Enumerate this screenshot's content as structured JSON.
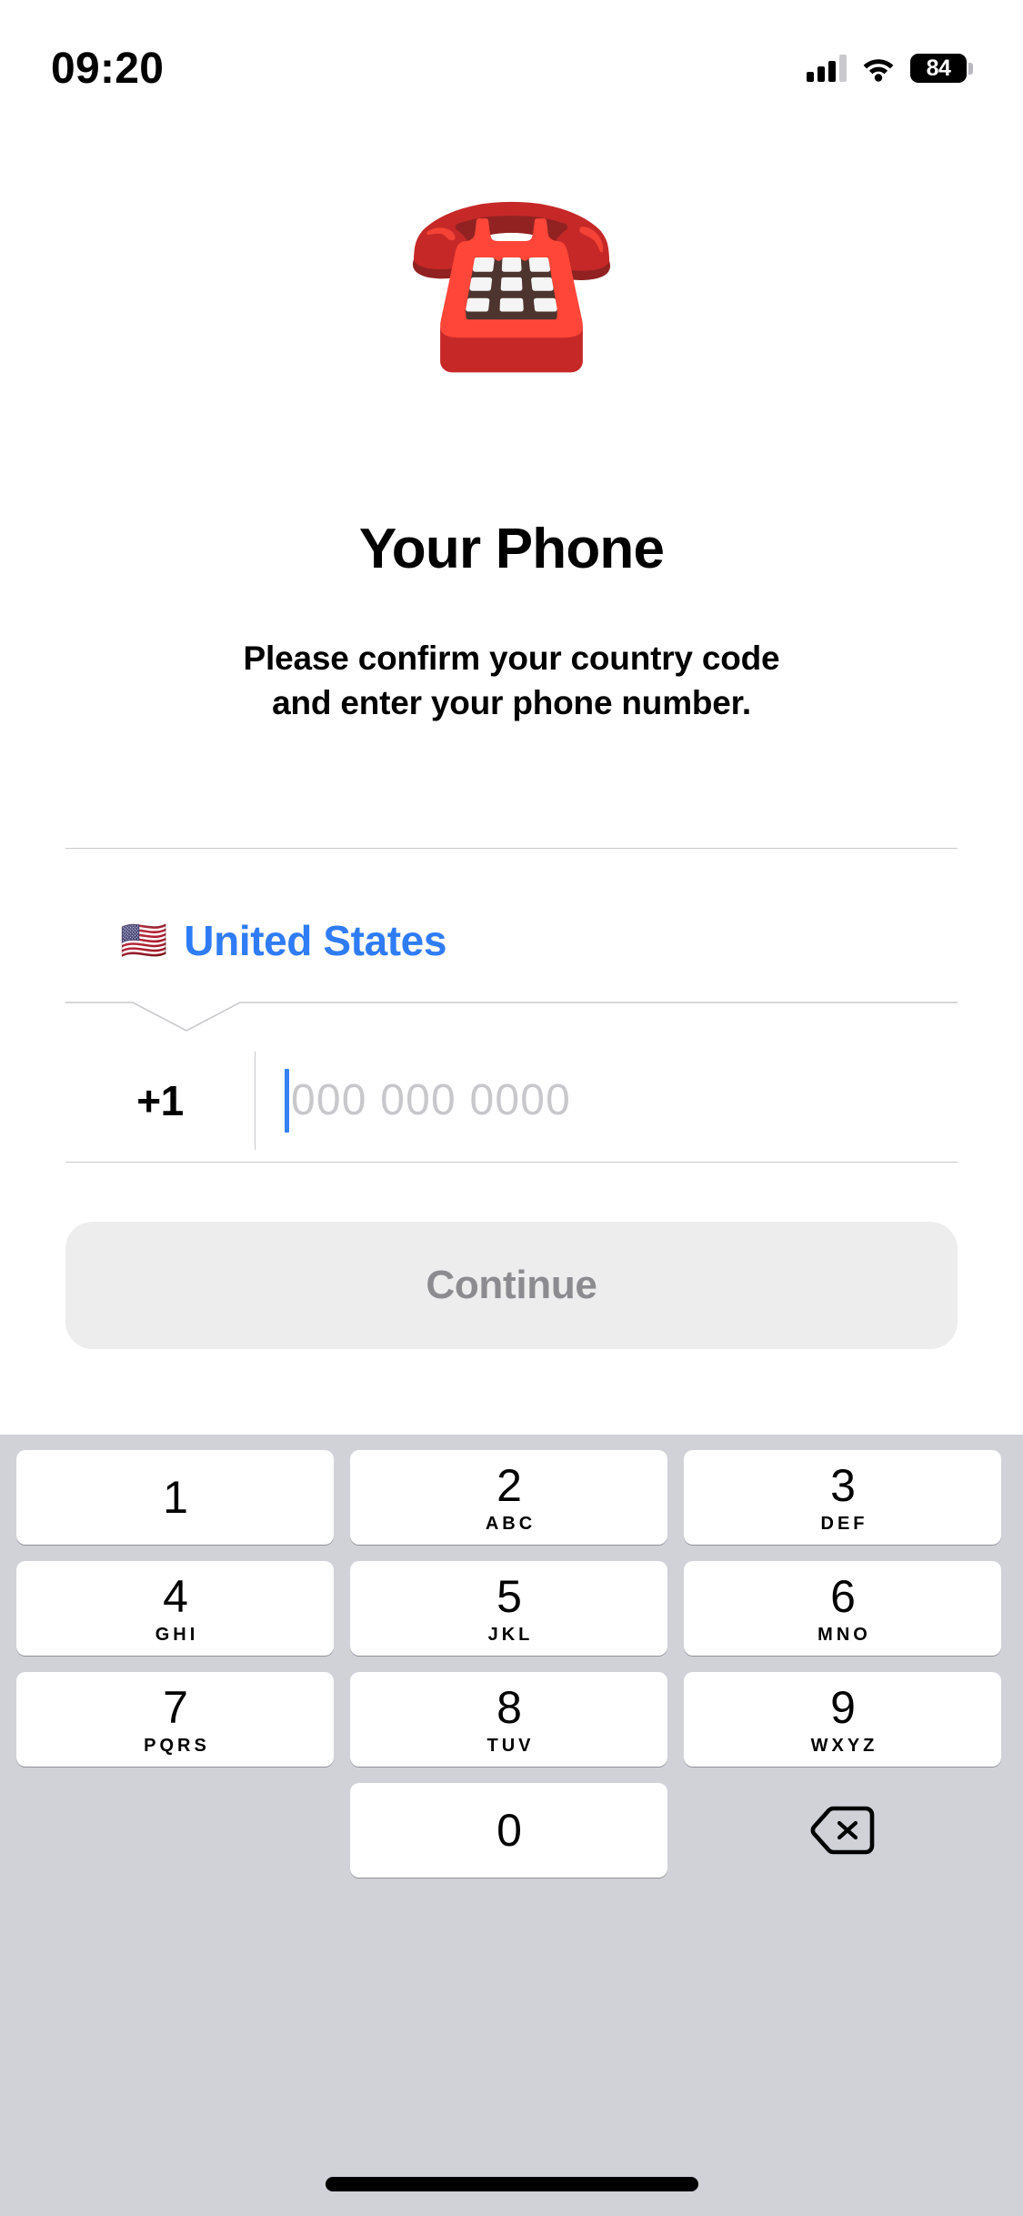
{
  "status_bar": {
    "time": "09:20",
    "signal_icon": "cellular-signal-icon",
    "wifi_icon": "wifi-icon",
    "battery_level": "84",
    "battery_icon": "battery-icon"
  },
  "header": {
    "emoji": "☎️",
    "emoji_name": "telephone-emoji",
    "title": "Your Phone",
    "subtitle_line1": "Please confirm your country code",
    "subtitle_line2": "and enter your phone number."
  },
  "form": {
    "country": {
      "flag": "🇺🇸",
      "name": "United States",
      "accent_color": "#2F7CF6"
    },
    "phone": {
      "dial_code": "+1",
      "value": "",
      "placeholder": "000 000 0000",
      "caret_color": "#3580F4",
      "placeholder_color": "#C8C8CC"
    }
  },
  "continue_button": {
    "label": "Continue",
    "background_color": "#EDEDEE",
    "text_color": "#8B8B90",
    "enabled": false
  },
  "keypad": {
    "background_color": "#D0D2D8",
    "key_color": "#FFFFFF",
    "rows": [
      [
        {
          "digit": "1",
          "letters": ""
        },
        {
          "digit": "2",
          "letters": "ABC"
        },
        {
          "digit": "3",
          "letters": "DEF"
        }
      ],
      [
        {
          "digit": "4",
          "letters": "GHI"
        },
        {
          "digit": "5",
          "letters": "JKL"
        },
        {
          "digit": "6",
          "letters": "MNO"
        }
      ],
      [
        {
          "digit": "7",
          "letters": "PQRS"
        },
        {
          "digit": "8",
          "letters": "TUV"
        },
        {
          "digit": "9",
          "letters": "WXYZ"
        }
      ],
      [
        {
          "digit": "",
          "letters": ""
        },
        {
          "digit": "0",
          "letters": ""
        },
        {
          "digit": "",
          "letters": "",
          "icon": "backspace-delete-icon"
        }
      ]
    ]
  },
  "home_indicator": {
    "name": "home-indicator"
  }
}
